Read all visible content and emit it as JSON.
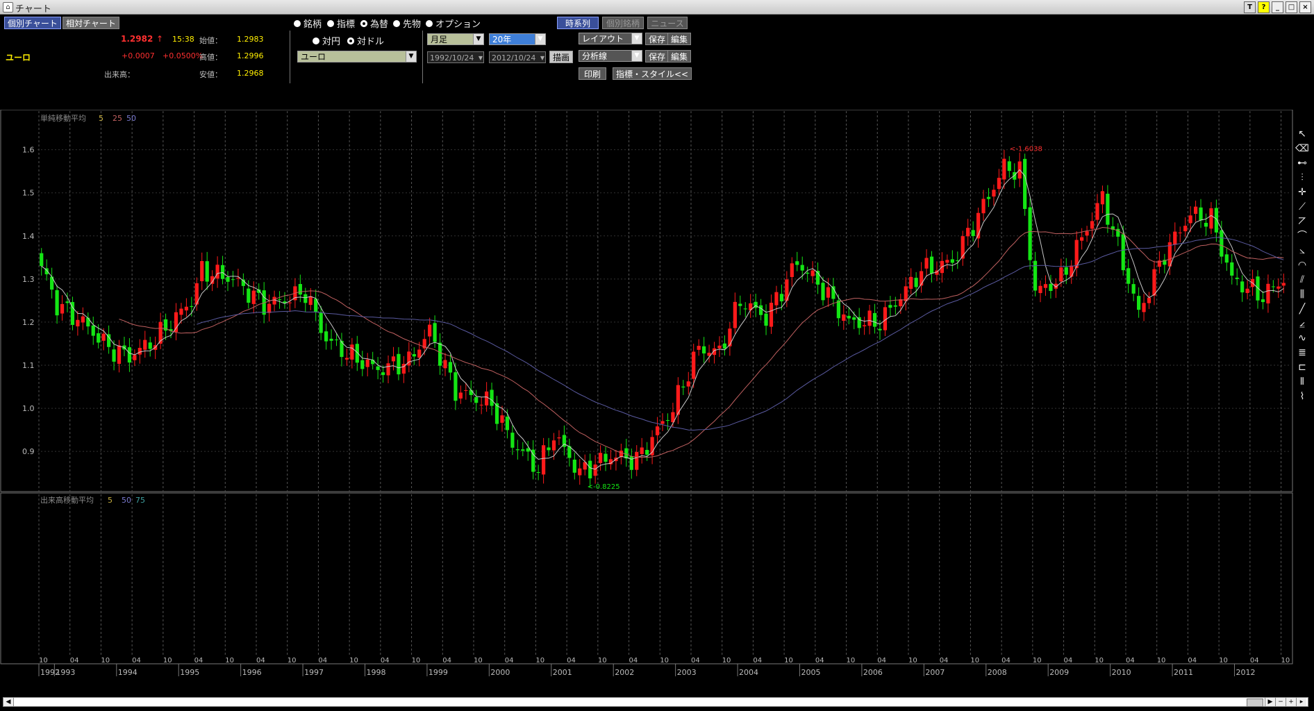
{
  "window": {
    "title": "チャート",
    "buttons": [
      "T",
      "?",
      "_",
      "□",
      "×"
    ]
  },
  "top": {
    "tab_individual": "個別チャート",
    "tab_relative": "相対チャート",
    "instrument": "ユーロ",
    "price": "1.2982",
    "arrow": "↑",
    "time": "15:38",
    "change": "+0.0007",
    "change_pct": "+0.0500%",
    "volume_label": "出来高：",
    "open_label": "始値：",
    "open_value": "1.2983",
    "high_label": "高値：",
    "high_value": "1.2996",
    "low_label": "安値：",
    "low_value": "1.2968"
  },
  "controls": {
    "types": [
      {
        "label": "銘柄",
        "selected": false
      },
      {
        "label": "指標",
        "selected": false
      },
      {
        "label": "為替",
        "selected": true
      },
      {
        "label": "先物",
        "selected": false
      },
      {
        "label": "オプション",
        "selected": false
      }
    ],
    "base_yen": "対円",
    "base_dollar": "対ドル",
    "currency": "ユーロ",
    "period": "月足",
    "range": "20年",
    "date_from": "1992/10/24",
    "date_to": "2012/10/24",
    "draw_button": "描画",
    "timeseries_button": "時系列",
    "individual_stock_button": "個別銘柄",
    "news_button": "ニュース",
    "layout": "レイアウト",
    "analysis": "分析線",
    "save": "保存",
    "edit": "編集",
    "print": "印刷",
    "indicator_style": "指標・スタイル<<"
  },
  "chart_data": {
    "type": "candlestick",
    "price_panel_title": "単純移動平均",
    "ma_periods": [
      "5",
      "25",
      "50"
    ],
    "volume_panel_title": "出来高移動平均",
    "volume_ma_periods": [
      "5",
      "50",
      "75"
    ],
    "y_ticks": [
      "1.6",
      "1.5",
      "1.4",
      "1.3",
      "1.2",
      "1.1",
      "1.0",
      "0.9"
    ],
    "ylim": [
      0.81,
      1.68
    ],
    "high_annotation": "<-1.6038",
    "low_annotation": "<-0.8225",
    "x_start": "1992-10",
    "x_end": "2012-10",
    "month_ticks": [
      "10",
      "04",
      "10",
      "04",
      "10",
      "04",
      "10",
      "04",
      "10",
      "04",
      "10",
      "04",
      "10",
      "04",
      "10",
      "04",
      "10",
      "04",
      "10",
      "04",
      "10",
      "04",
      "10",
      "04",
      "10",
      "04",
      "10",
      "04",
      "10",
      "04",
      "10",
      "04",
      "10",
      "04",
      "10",
      "04",
      "10",
      "04",
      "10",
      "04",
      "10"
    ],
    "year_labels": [
      "1992",
      "1993",
      "1994",
      "1995",
      "1996",
      "1997",
      "1998",
      "1999",
      "2000",
      "2001",
      "2002",
      "2003",
      "2004",
      "2005",
      "2006",
      "2007",
      "2008",
      "2009",
      "2010",
      "2011",
      "2012"
    ],
    "close_anchors": [
      [
        "1992-10",
        1.33
      ],
      [
        "1993-01",
        1.24
      ],
      [
        "1993-06",
        1.2
      ],
      [
        "1993-11",
        1.14
      ],
      [
        "1994-03",
        1.12
      ],
      [
        "1994-08",
        1.16
      ],
      [
        "1995-03",
        1.25
      ],
      [
        "1995-05",
        1.32
      ],
      [
        "1995-11",
        1.3
      ],
      [
        "1996-05",
        1.24
      ],
      [
        "1996-11",
        1.26
      ],
      [
        "1997-01",
        1.27
      ],
      [
        "1997-05",
        1.16
      ],
      [
        "1997-10",
        1.12
      ],
      [
        "1998-03",
        1.09
      ],
      [
        "1998-09",
        1.11
      ],
      [
        "1999-01",
        1.18
      ],
      [
        "1999-06",
        1.04
      ],
      [
        "2000-01",
        1.01
      ],
      [
        "2000-05",
        0.92
      ],
      [
        "2000-10",
        0.86
      ],
      [
        "2001-01",
        0.94
      ],
      [
        "2001-06",
        0.85
      ],
      [
        "2001-12",
        0.89
      ],
      [
        "2002-05",
        0.88
      ],
      [
        "2002-12",
        1.0
      ],
      [
        "2003-05",
        1.14
      ],
      [
        "2003-09",
        1.13
      ],
      [
        "2004-01",
        1.25
      ],
      [
        "2004-06",
        1.21
      ],
      [
        "2004-12",
        1.34
      ],
      [
        "2005-04",
        1.29
      ],
      [
        "2005-10",
        1.2
      ],
      [
        "2006-04",
        1.2
      ],
      [
        "2006-12",
        1.32
      ],
      [
        "2007-06",
        1.34
      ],
      [
        "2007-12",
        1.47
      ],
      [
        "2008-04",
        1.56
      ],
      [
        "2008-07",
        1.55
      ],
      [
        "2008-10",
        1.27
      ],
      [
        "2009-03",
        1.3
      ],
      [
        "2009-11",
        1.49
      ],
      [
        "2010-06",
        1.22
      ],
      [
        "2010-11",
        1.36
      ],
      [
        "2011-04",
        1.45
      ],
      [
        "2011-08",
        1.44
      ],
      [
        "2011-12",
        1.3
      ],
      [
        "2012-06",
        1.26
      ],
      [
        "2012-10",
        1.3
      ]
    ],
    "colors": {
      "up": "#ff1a1a",
      "down": "#14e614",
      "ma5": "#c8c8c8",
      "ma25": "#c06060",
      "ma50": "#5a5aa0"
    }
  }
}
